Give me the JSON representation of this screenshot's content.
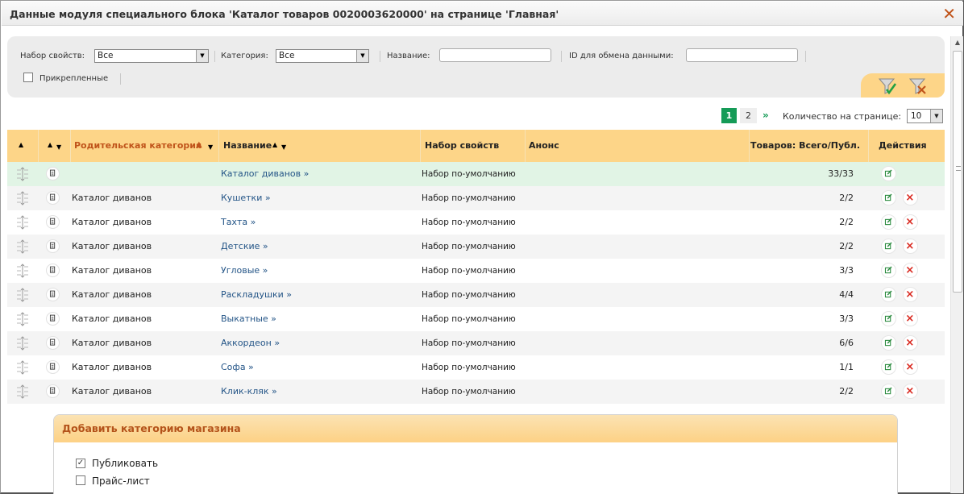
{
  "window": {
    "title": "Данные модуля специального блока 'Каталог товаров 0020003620000' на странице 'Главная'"
  },
  "filters": {
    "property_set_label": "Набор свойств:",
    "property_set_value": "Все",
    "category_label": "Категория:",
    "category_value": "Все",
    "name_label": "Название:",
    "name_value": "",
    "exchange_id_label": "ID для обмена данными:",
    "exchange_id_value": "",
    "pinned_label": "Прикрепленные",
    "pinned_checked": false
  },
  "pagination": {
    "current_page": "1",
    "next_page": "2",
    "next_label": "»",
    "per_page_label": "Количество на странице:",
    "per_page_value": "10"
  },
  "table": {
    "columns": {
      "parent_category": "Родительская категория",
      "name": "Название",
      "property_set": "Набор свойств",
      "announce": "Анонс",
      "goods": "Товаров: Всего/Публ.",
      "actions": "Действия"
    },
    "rows": [
      {
        "parent": "",
        "name": "Каталог диванов »",
        "property_set": "Набор по-умолчанию",
        "announce": "",
        "goods": "33/33",
        "highlighted": true,
        "deletable": false
      },
      {
        "parent": "Каталог диванов",
        "name": "Кушетки »",
        "property_set": "Набор по-умолчанию",
        "announce": "",
        "goods": "2/2",
        "highlighted": false,
        "deletable": true
      },
      {
        "parent": "Каталог диванов",
        "name": "Тахта »",
        "property_set": "Набор по-умолчанию",
        "announce": "",
        "goods": "2/2",
        "highlighted": false,
        "deletable": true
      },
      {
        "parent": "Каталог диванов",
        "name": "Детские »",
        "property_set": "Набор по-умолчанию",
        "announce": "",
        "goods": "2/2",
        "highlighted": false,
        "deletable": true
      },
      {
        "parent": "Каталог диванов",
        "name": "Угловые »",
        "property_set": "Набор по-умолчанию",
        "announce": "",
        "goods": "3/3",
        "highlighted": false,
        "deletable": true
      },
      {
        "parent": "Каталог диванов",
        "name": "Раскладушки »",
        "property_set": "Набор по-умолчанию",
        "announce": "",
        "goods": "4/4",
        "highlighted": false,
        "deletable": true
      },
      {
        "parent": "Каталог диванов",
        "name": "Выкатные »",
        "property_set": "Набор по-умолчанию",
        "announce": "",
        "goods": "3/3",
        "highlighted": false,
        "deletable": true
      },
      {
        "parent": "Каталог диванов",
        "name": "Аккордеон »",
        "property_set": "Набор по-умолчанию",
        "announce": "",
        "goods": "6/6",
        "highlighted": false,
        "deletable": true
      },
      {
        "parent": "Каталог диванов",
        "name": "Софа »",
        "property_set": "Набор по-умолчанию",
        "announce": "",
        "goods": "1/1",
        "highlighted": false,
        "deletable": true
      },
      {
        "parent": "Каталог диванов",
        "name": "Клик-кляк »",
        "property_set": "Набор по-умолчанию",
        "announce": "",
        "goods": "2/2",
        "highlighted": false,
        "deletable": true
      }
    ]
  },
  "add_panel": {
    "title": "Добавить категорию магазина",
    "publish_label": "Публиковать",
    "publish_checked": true,
    "price_list_label": "Прайс-лист",
    "price_list_checked": false
  },
  "colors": {
    "accent_orange": "#c0541b",
    "header_bg": "#fdd588",
    "link": "#245587",
    "green": "#159b57",
    "delete_red": "#d9281f"
  },
  "icons": {
    "close": "close-icon",
    "apply_filter": "filter-apply-icon",
    "clear_filter": "filter-clear-icon",
    "drag": "drag-handle-icon",
    "document": "document-icon",
    "edit": "edit-icon",
    "delete": "delete-icon"
  }
}
